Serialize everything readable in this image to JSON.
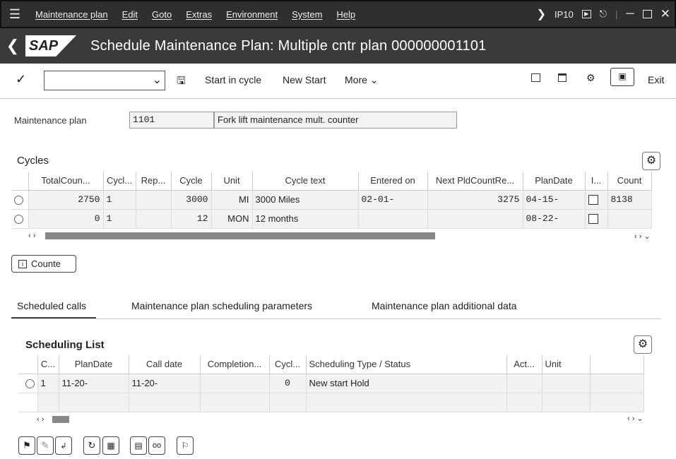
{
  "menubar": {
    "items": [
      "Maintenance plan",
      "Edit",
      "Goto",
      "Extras",
      "Environment",
      "System",
      "Help"
    ],
    "system": "IP10"
  },
  "title": "Schedule Maintenance Plan: Multiple cntr plan 000000001101",
  "toolbar": {
    "command_value": "",
    "start_in_cycle": "Start in cycle",
    "new_start": "New Start",
    "more": "More",
    "exit": "Exit"
  },
  "header": {
    "plan_label": "Maintenance plan",
    "plan_number": "1101",
    "plan_text": "Fork lift maintenance mult. counter"
  },
  "cycles": {
    "title": "Cycles",
    "columns": [
      "TotalCoun...",
      "Cycl...",
      "Rep...",
      "Cycle",
      "Unit",
      "Cycle text",
      "Entered on",
      "Next PldCountRe...",
      "PlanDate",
      "I...",
      "Count"
    ],
    "rows": [
      [
        "2750",
        "1",
        "",
        "3000",
        "MI",
        "3000 Miles",
        "02-01-",
        "3275",
        "04-15-",
        "",
        "8138"
      ],
      [
        "0",
        "1",
        "",
        "12",
        "MON",
        "12 months",
        "",
        "",
        "08-22-",
        "",
        ""
      ]
    ],
    "counter_button": "Counte"
  },
  "tabs": [
    "Scheduled calls",
    "Maintenance plan scheduling parameters",
    "Maintenance plan additional data"
  ],
  "scheduling": {
    "title": "Scheduling List",
    "columns": [
      "C...",
      "PlanDate",
      "Call date",
      "Completion...",
      "Cycl...",
      "Scheduling Type / Status",
      "Act...",
      "Unit"
    ],
    "rows": [
      [
        "1",
        "11-20-",
        "11-20-",
        "",
        "0",
        "New start  Hold",
        "",
        ""
      ]
    ]
  }
}
